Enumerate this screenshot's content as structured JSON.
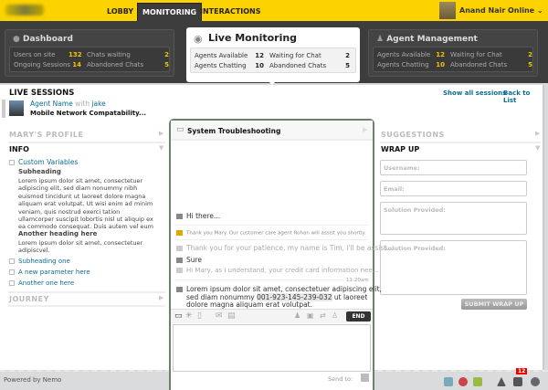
{
  "nav": {
    "tabs": [
      "LOBBY",
      "MONITORING",
      "INTERACTIONS"
    ],
    "user": "Anand Nair",
    "status": "Online"
  },
  "dashboard": {
    "title": "Dashboard",
    "stats": [
      {
        "label": "Users on site",
        "value": "132"
      },
      {
        "label": "Chats waiting",
        "value": "2"
      },
      {
        "label": "Ongoing Sessions",
        "value": "14"
      },
      {
        "label": "Abandoned Chats",
        "value": "5"
      }
    ]
  },
  "live": {
    "title": "Live Monitoring",
    "stats": [
      {
        "label": "Agents Available",
        "value": "12"
      },
      {
        "label": "Waiting for Chat",
        "value": "2"
      },
      {
        "label": "Agents Chatting",
        "value": "10"
      },
      {
        "label": "Abandoned Chats",
        "value": "5"
      }
    ]
  },
  "agent": {
    "title": "Agent Management",
    "stats": [
      {
        "label": "Agents Available",
        "value": "12"
      },
      {
        "label": "Waiting for Chat",
        "value": "2"
      },
      {
        "label": "Agents Chatting",
        "value": "10"
      },
      {
        "label": "Abandoned Chats",
        "value": "5"
      }
    ]
  },
  "sessions": {
    "title": "LIVE SESSIONS",
    "agent": "Agent Name",
    "with": "with",
    "customer": "jake",
    "topic": "Mobile Network Compatability...",
    "show_all": "Show all sessions",
    "back": "Back to List"
  },
  "left": {
    "profile": "MARY'S PROFILE",
    "info": "INFO",
    "custom": "Custom Variables",
    "sub": "Subheading",
    "lorem1": "Lorem ipsum dolor sit amet, consectetuer adipiscing elit, sed diam nonummy nibh euismod tincidunt ut laoreet dolore magna aliquam erat volutpat. Ut wisi enim ad minim veniam, quis nostrud exerci tation ullamcorper suscipit lobortis nisl ut aliquip ex ea commodo consequat. Duis autem vel eum",
    "another": "Another heading here",
    "lorem2": "Lorem ipsum dolor sit amet, consectetuer adipiscvel.",
    "links": [
      "Subheading one",
      "A new parameter here",
      "Another one here"
    ],
    "journey": "JOURNEY"
  },
  "chat": {
    "title": "System Troubleshooting",
    "m1": "Hi there...",
    "sys": "Thank you Mary. Our customer care agent Rohan will assist you shortly.",
    "m2": "Thank you for your patience, my name is Tim, i'll be assist...",
    "m3": "Sure",
    "m4": "Hi Mary, as I understand, your credit card information nee...",
    "time": "11:20am",
    "m5a": "Lorem ipsum dolor sit amet, consectetuer adipiscing elit,",
    "m5b": "sed diam nonummy",
    "phone": "001-923-145-239-032",
    "m5c": "ut laoreet",
    "m5d": "dolore magna aliquam erat volutpat.",
    "end": "END",
    "send_to": "Send to:"
  },
  "right": {
    "suggestions": "SUGGESTIONS",
    "wrap": "WRAP UP",
    "username": "Username:",
    "email": "Email:",
    "solution1": "Solution Provided:",
    "solution2": "Solution Provided:",
    "submit": "SUBMIT WRAP UP"
  },
  "footer": {
    "powered": "Powered by Nemo",
    "badge": "12"
  }
}
